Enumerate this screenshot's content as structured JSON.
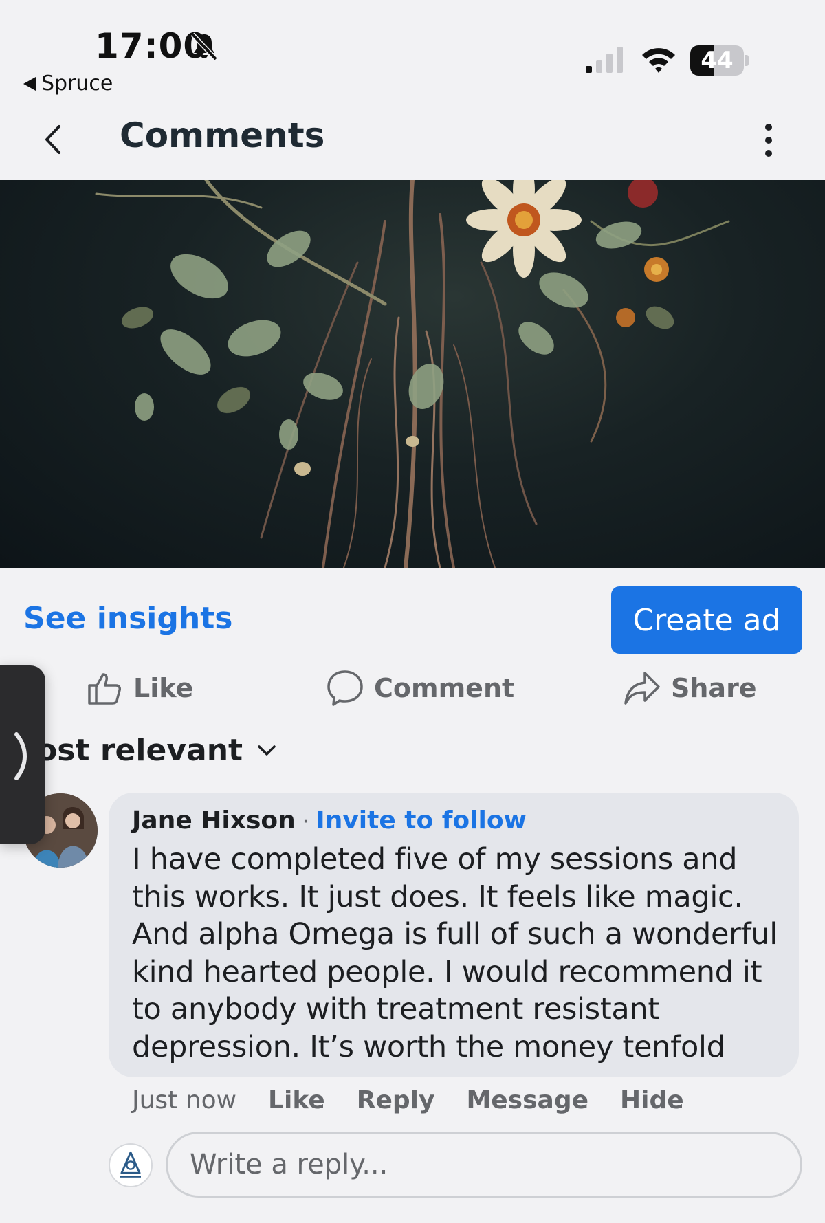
{
  "status_bar": {
    "time": "17:00",
    "back_app": "Spruce",
    "battery_percent": 44,
    "battery_label": "44"
  },
  "header": {
    "title": "Comments"
  },
  "post": {
    "image_icon": "flower-roots-artwork"
  },
  "insights": {
    "see_insights": "See insights",
    "create_ad": "Create ad"
  },
  "actions": {
    "like": "Like",
    "comment": "Comment",
    "share": "Share"
  },
  "sort": {
    "label": "lost relevant"
  },
  "comment": {
    "author": "Jane Hixson",
    "separator": "·",
    "invite": "Invite to follow",
    "text": "I have completed five of my sessions and this works. It just does. It feels like magic. And alpha Omega is full of such a wonderful kind hearted people. I would recommend it to anybody with treatment resistant depression. It’s worth the money tenfold",
    "time": "Just now",
    "like": "Like",
    "reply": "Reply",
    "message": "Message",
    "hide": "Hide"
  },
  "reply": {
    "placeholder": "Write a reply..."
  },
  "colors": {
    "accent": "#1b74e4",
    "background": "#f2f2f4",
    "bubble": "#e4e6eb",
    "secondary_text": "#65676b"
  }
}
